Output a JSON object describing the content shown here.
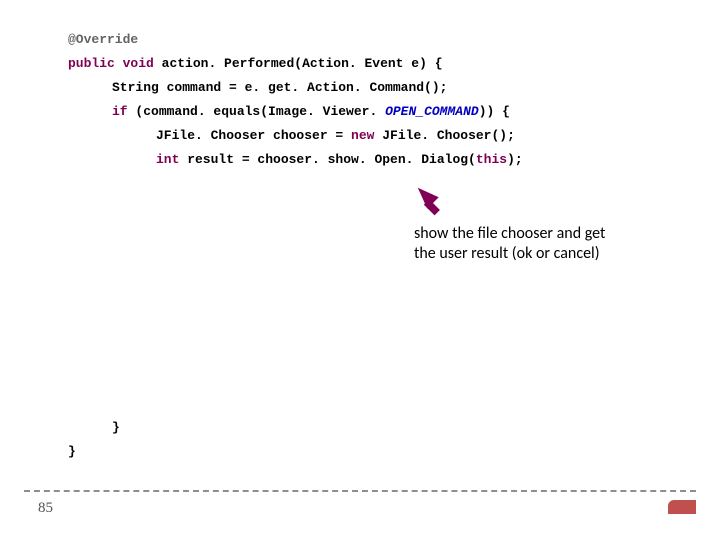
{
  "code": {
    "l1_annotation": "@Override",
    "l2_kw_public": "public",
    "l2_kw_void": "void",
    "l2_rest": " action. Performed(Action. Event e) {",
    "l3": "String command = e. get. Action. Command();",
    "l4_kw_if": "if",
    "l4_rest": " (command. equals(Image. Viewer. ",
    "l4_const": "OPEN_COMMAND",
    "l4_close": ")) {",
    "l5_a": "JFile. Chooser chooser = ",
    "l5_kw_new": "new",
    "l5_b": " JFile. Chooser();",
    "l6_kw_int": "int",
    "l6_a": " result = chooser. show. Open. Dialog(",
    "l6_kw_this": "this",
    "l6_b": ");",
    "l7": "}",
    "l8": "}"
  },
  "callout_text": "show the file chooser and get the user result (ok or cancel)",
  "page_number": "85"
}
